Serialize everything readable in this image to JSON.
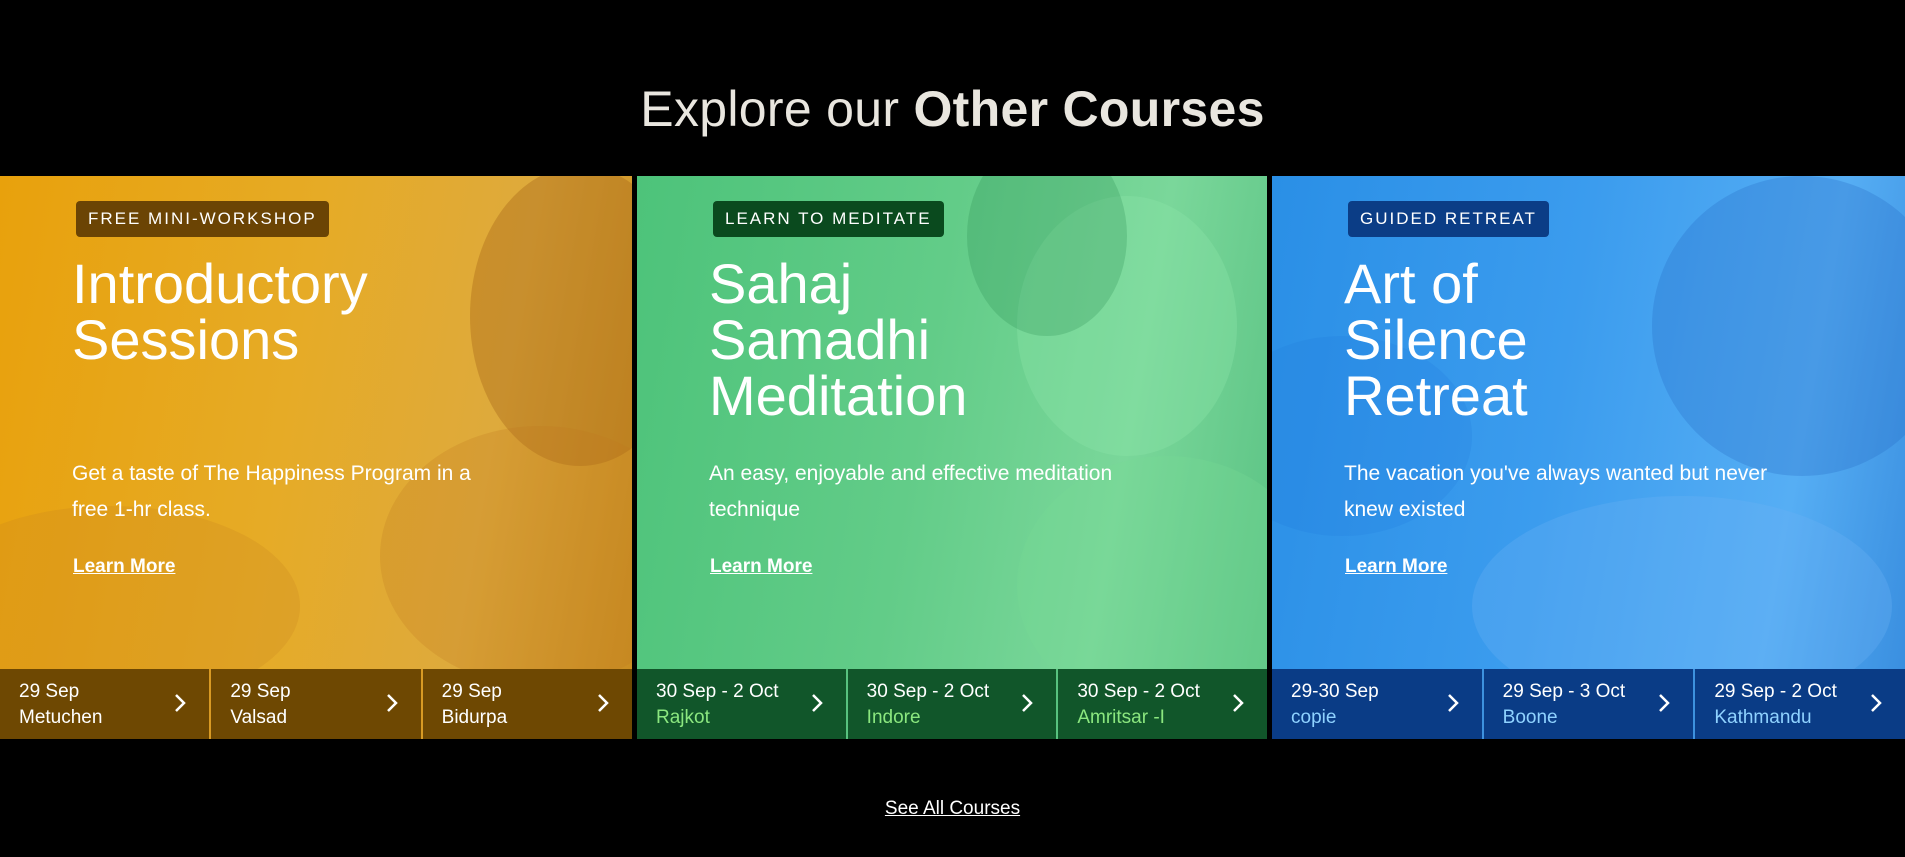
{
  "heading": {
    "light": "Explore our ",
    "bold": "Other Courses"
  },
  "cards": [
    {
      "badge": "FREE MINI-WORKSHOP",
      "title": "Introductory\nSessions",
      "description": "Get a taste of The Happiness Program in a free 1-hr class.",
      "link": "Learn More",
      "accent": "#e8a10c",
      "dates": [
        {
          "range": "29 Sep",
          "location": "Metuchen"
        },
        {
          "range": "29 Sep",
          "location": "Valsad"
        },
        {
          "range": "29 Sep",
          "location": "Bidurpa"
        }
      ]
    },
    {
      "badge": "LEARN TO MEDITATE",
      "title": "Sahaj\nSamadhi\nMeditation",
      "description": "An easy, enjoyable and effective meditation technique",
      "link": "Learn More",
      "accent": "#4dc37a",
      "dates": [
        {
          "range": "30 Sep - 2 Oct",
          "location": "Rajkot"
        },
        {
          "range": "30 Sep - 2 Oct",
          "location": "Indore"
        },
        {
          "range": "30 Sep - 2 Oct",
          "location": "Amritsar -I"
        }
      ]
    },
    {
      "badge": "GUIDED RETREAT",
      "title": "Art of\nSilence\nRetreat",
      "description": "The vacation you've always wanted but never knew existed",
      "link": "Learn More",
      "accent": "#2a8fe6",
      "dates": [
        {
          "range": "29-30 Sep",
          "location": "copie"
        },
        {
          "range": "29 Sep - 3 Oct",
          "location": "Boone"
        },
        {
          "range": "29 Sep - 2 Oct",
          "location": "Kathmandu"
        }
      ]
    }
  ],
  "footer": {
    "see_all": "See All Courses"
  }
}
